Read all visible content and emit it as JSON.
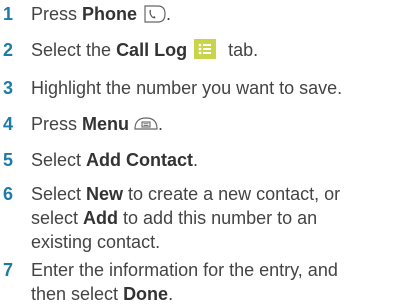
{
  "steps": [
    {
      "num": "1",
      "parts": [
        "Press ",
        "Phone",
        "."
      ],
      "icon": "phone-key-icon"
    },
    {
      "num": "2",
      "parts": [
        "Select the ",
        "Call Log",
        " tab."
      ],
      "icon": "call-log-tab-icon"
    },
    {
      "num": "3",
      "text": "Highlight the number you want to save."
    },
    {
      "num": "4",
      "parts": [
        "Press ",
        "Menu",
        "."
      ],
      "icon": "menu-key-icon"
    },
    {
      "num": "5",
      "parts": [
        "Select ",
        "Add Contact",
        "."
      ]
    },
    {
      "num": "6",
      "parts": [
        "Select ",
        "New",
        " to create a new contact, or",
        "select ",
        "Add",
        " to add this number to an",
        "existing contact."
      ]
    },
    {
      "num": "7",
      "parts": [
        "Enter the information for the entry, and",
        "then select ",
        "Done",
        "."
      ]
    }
  ],
  "colors": {
    "step_number": "#1e7aa7",
    "body_text": "#444444",
    "call_log_icon": "#c9d44a"
  }
}
